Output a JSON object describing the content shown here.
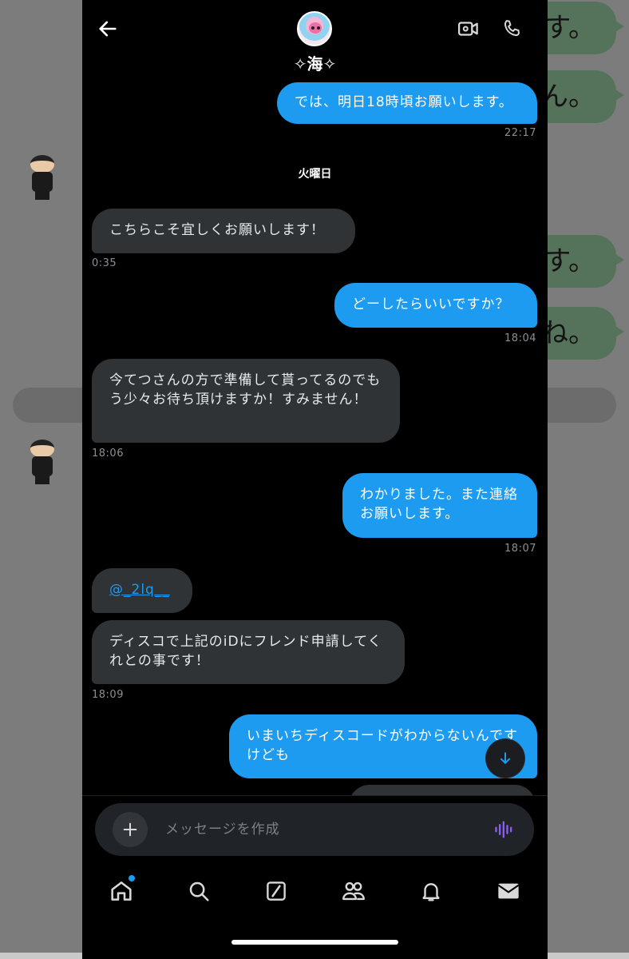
{
  "background_app": {
    "bubble_texts": [
      "す。",
      "ん。",
      "す。",
      "ね。"
    ]
  },
  "header": {
    "peer_name": "✧海✧",
    "icons": [
      "back-arrow-icon",
      "video-call-icon",
      "phone-icon"
    ]
  },
  "conversation": {
    "day_separator": "火曜日",
    "messages": [
      {
        "dir": "out",
        "text": "では、明日18時頃お願いします。",
        "time": "22:17"
      },
      {
        "dir": "in",
        "text": "こちらこそ宜しくお願いします！",
        "time": "0:35"
      },
      {
        "dir": "out",
        "text": "どーしたらいいですか？",
        "time": "18:04"
      },
      {
        "dir": "in",
        "text": "今てつさんの方で準備して貰ってるのでもう少々お待ち頂けますか！すみません！",
        "time": "18:06"
      },
      {
        "dir": "out",
        "text": "わかりました。また連絡お願いします。",
        "time": "18:07"
      },
      {
        "dir": "in",
        "text": "@_2lq__"
      },
      {
        "dir": "in",
        "text": "ディスコで上記のiDにフレンド申請してくれとの事です！",
        "time": "18:09"
      },
      {
        "dir": "out",
        "text": "いまいちディスコードがわからないんですけども"
      }
    ]
  },
  "composer": {
    "placeholder": "メッセージを作成"
  },
  "tabbar": {
    "items": [
      "home-icon",
      "search-icon",
      "grok-icon",
      "communities-icon",
      "notifications-icon",
      "messages-icon"
    ]
  },
  "colors": {
    "accent": "#1d9bf0",
    "incoming_bubble": "#2f3336",
    "voice": "#8b5cf6"
  }
}
